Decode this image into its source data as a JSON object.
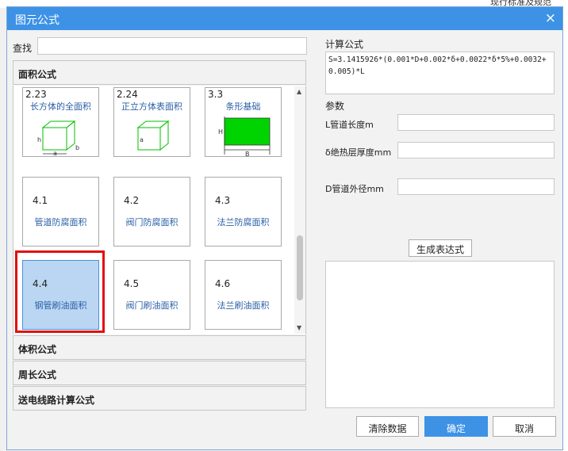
{
  "background": {
    "text": "现行标准及规范"
  },
  "dialog": {
    "title": "图元公式",
    "close_glyph": "×"
  },
  "search": {
    "label": "查找",
    "value": ""
  },
  "sections": {
    "area": "面积公式",
    "volume": "体积公式",
    "perimeter": "周长公式",
    "transmission": "送电线路计算公式"
  },
  "cards": [
    {
      "num": "2.23",
      "name": "长方体的全面积"
    },
    {
      "num": "2.24",
      "name": "正立方体表面积"
    },
    {
      "num": "3.3",
      "name": "条形基础"
    },
    {
      "num": "4.1",
      "name": "管道防腐面积"
    },
    {
      "num": "4.2",
      "name": "阀门防腐面积"
    },
    {
      "num": "4.3",
      "name": "法兰防腐面积"
    },
    {
      "num": "4.4",
      "name": "钢管刷油面积"
    },
    {
      "num": "4.5",
      "name": "阀门刷油面积"
    },
    {
      "num": "4.6",
      "name": "法兰刷油面积"
    }
  ],
  "diagram_labels": {
    "h": "h",
    "a": "a",
    "b": "b",
    "H": "H",
    "B": "B"
  },
  "formula": {
    "label": "计算公式",
    "value": "S=3.1415926*(0.001*D+0.002*δ+0.0022*δ*5%+0.0032+0.005)*L"
  },
  "params": {
    "label": "参数",
    "items": [
      {
        "label": "L管道长度m",
        "value": ""
      },
      {
        "label": "δ绝热层厚度mm",
        "value": ""
      },
      {
        "label": "D管道外径mm",
        "value": ""
      }
    ]
  },
  "buttons": {
    "generate": "生成表达式",
    "clear": "清除数据",
    "ok": "确定",
    "cancel": "取消"
  },
  "output": {
    "value": ""
  },
  "colors": {
    "titlebar": "#3d92e6",
    "accent_green": "#00d400",
    "selection": "#bad6f2",
    "highlight": "#e01010"
  }
}
